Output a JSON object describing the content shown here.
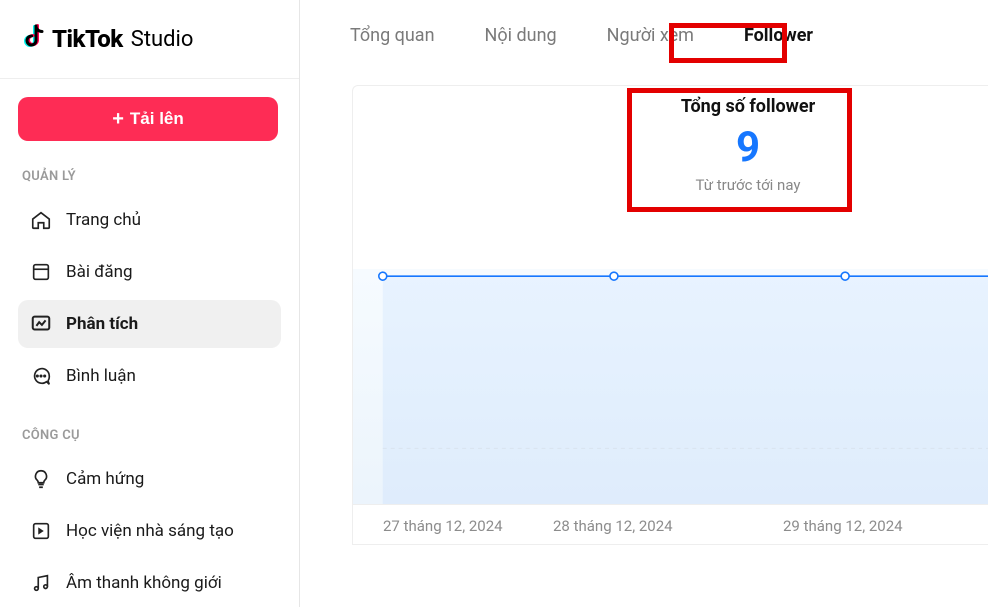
{
  "logo": {
    "tiktok": "TikTok",
    "studio": "Studio"
  },
  "upload_label": "Tải lên",
  "sections": {
    "manage": "QUẢN LÝ",
    "tools": "CÔNG CỤ"
  },
  "nav": {
    "home": "Trang chủ",
    "posts": "Bài đăng",
    "analytics": "Phân tích",
    "comments": "Bình luận",
    "inspiration": "Cảm hứng",
    "academy": "Học viện nhà sáng tạo",
    "audio": "Âm thanh không giới"
  },
  "tabs": {
    "overview": "Tổng quan",
    "content": "Nội dung",
    "viewers": "Người xem",
    "followers": "Follower"
  },
  "stat": {
    "title": "Tổng số follower",
    "value": "9",
    "subtitle": "Từ trước tới nay"
  },
  "chart_data": {
    "type": "line",
    "title": "Tổng số follower",
    "categories": [
      "27 tháng 12, 2024",
      "28 tháng 12, 2024",
      "29 tháng 12, 2024"
    ],
    "values": [
      9,
      9,
      9
    ],
    "ylim": [
      0,
      10
    ],
    "xlabel": "",
    "ylabel": ""
  }
}
